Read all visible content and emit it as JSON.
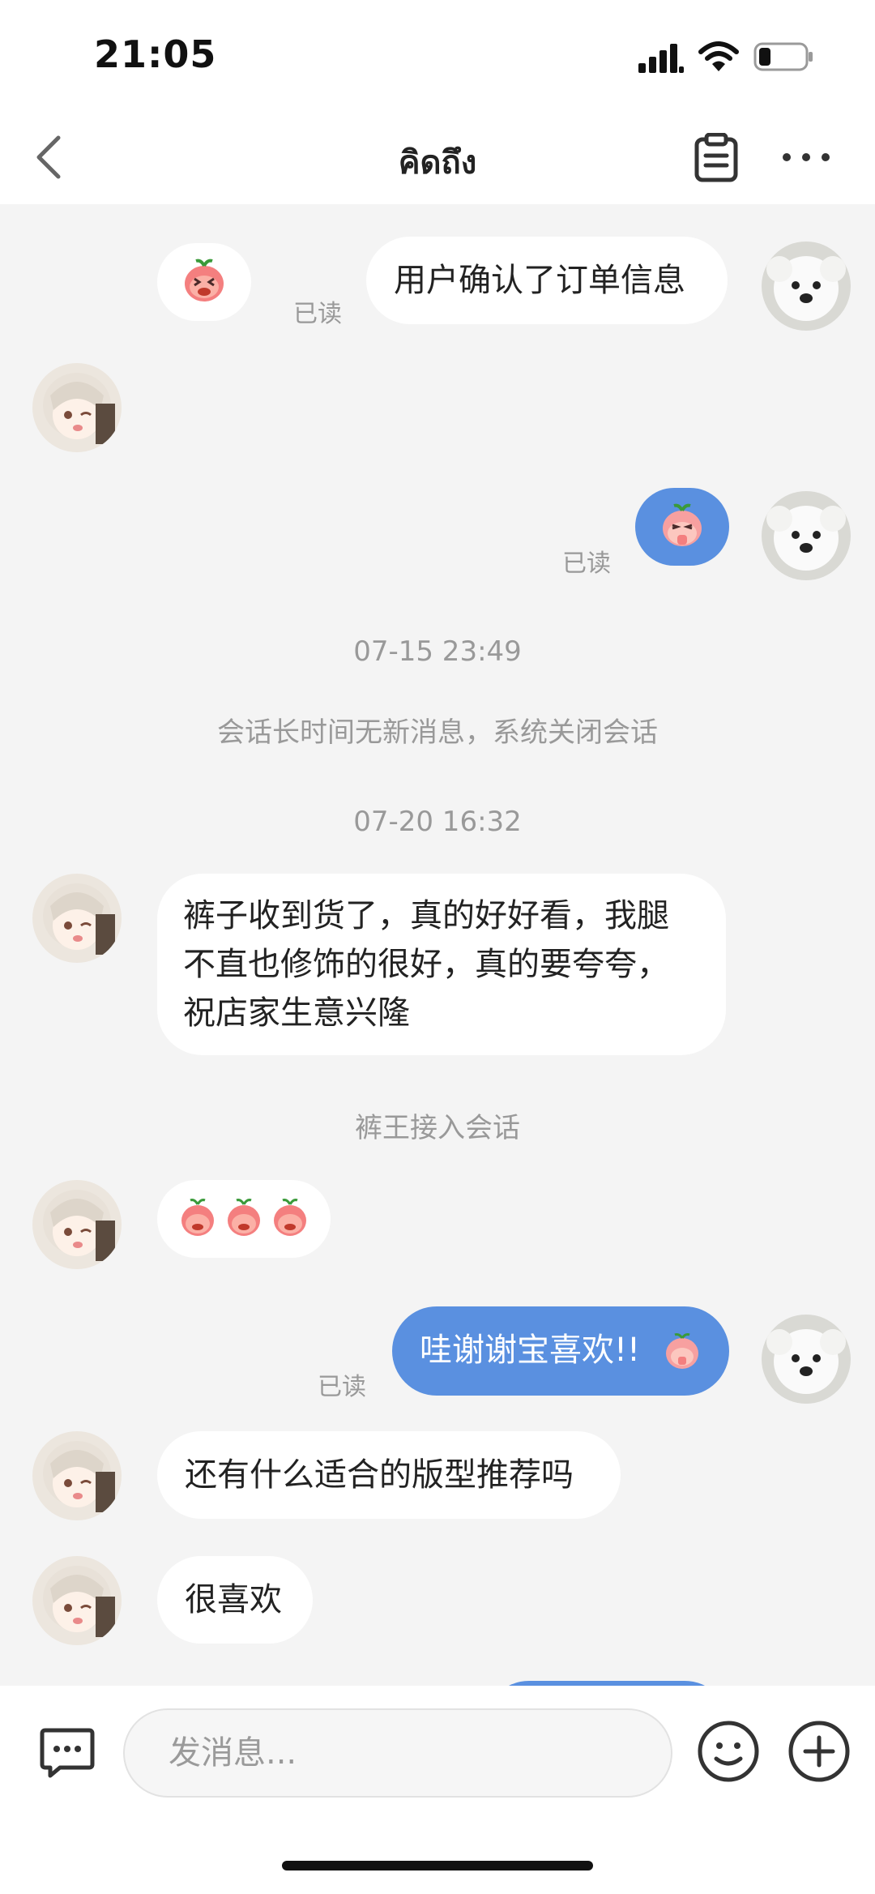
{
  "status": {
    "time": "21:05"
  },
  "nav": {
    "title": "คิดถึง"
  },
  "messages": {
    "m1": {
      "text": "用户确认了订单信息",
      "read": "已读"
    },
    "m3": {
      "read": "已读"
    },
    "time1": "07-15 23:49",
    "system1": "会话长时间无新消息，系统关闭会话",
    "time2": "07-20 16:32",
    "m4": {
      "text": "裤子收到货了，真的好好看，我腿不直也修饰的很好，真的要夸夸，祝店家生意兴隆"
    },
    "system2": "裤王接入会话",
    "m6": {
      "text": "哇谢谢宝喜欢!!",
      "read": "已读"
    },
    "m7": {
      "text": "还有什么适合的版型推荐吗"
    },
    "m8": {
      "text": "很喜欢"
    }
  },
  "input": {
    "placeholder": "发消息..."
  },
  "colors": {
    "accent": "#5a90e0",
    "background": "#f4f4f4"
  }
}
